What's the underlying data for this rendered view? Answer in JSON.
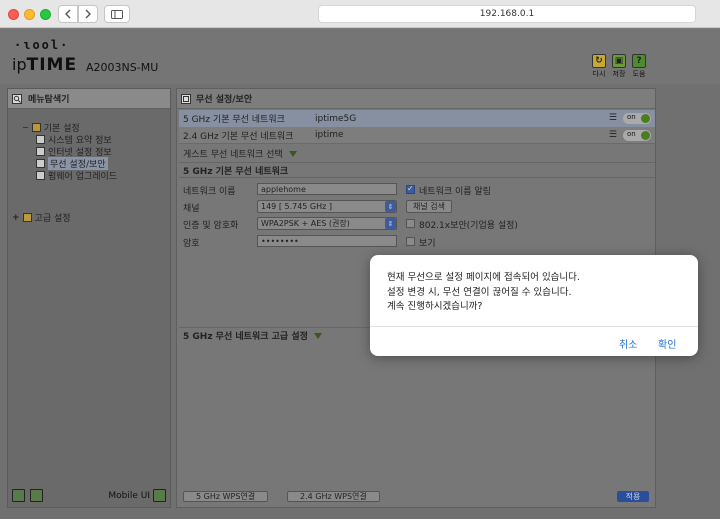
{
  "browser": {
    "url": "192.168.0.1"
  },
  "header": {
    "logo_dots": "·ɩool·",
    "logo_prefix": "ip",
    "logo_brand": "TIME",
    "model": "A2003NS-MU",
    "buttons": [
      {
        "label": "다시",
        "icon": "refresh-icon",
        "color": "#c8a830"
      },
      {
        "label": "저장",
        "icon": "save-icon",
        "color": "#6a9a3a"
      },
      {
        "label": "도움",
        "icon": "help-icon",
        "color": "#4e8a2e"
      }
    ]
  },
  "leftnav": {
    "title": "메뉴탐색기",
    "items": [
      {
        "label": "기본 설정",
        "level": 0,
        "prefix": "−"
      },
      {
        "label": "시스템 요약 정보",
        "level": 1
      },
      {
        "label": "인터넷 설정 정보",
        "level": 1
      },
      {
        "label": "무선 설정/보안",
        "level": 1,
        "selected": true
      },
      {
        "label": "펌웨어 업그레이드",
        "level": 1
      },
      {
        "label": "고급 설정",
        "level": 0,
        "prefix": "+"
      }
    ],
    "footer_label": "Mobile UI"
  },
  "main": {
    "title": "무선 설정/보안",
    "bands": [
      {
        "band": "5 GHz 기본 무선 네트워크",
        "ssid": "iptime5G",
        "toggle": "on"
      },
      {
        "band": "2.4 GHz 기본 무선 네트워크",
        "ssid": "iptime",
        "toggle": "on"
      }
    ],
    "guest_label": "게스트 무선 네트워크 선택",
    "section_title": "5 GHz 기본 무선 네트워크",
    "form": {
      "network_name_label": "네트워크 이름",
      "network_name_value": "applehome",
      "broadcast_label": "네트워크 이름 알림",
      "channel_label": "채널",
      "channel_value": "149 [ 5.745 GHz ]",
      "channel_search": "채널 검색",
      "auth_label": "인증 및 암호화",
      "auth_value": "WPA2PSK + AES (권장)",
      "enterprise_label": "802.1x보안(기업용 설정)",
      "password_label": "암호",
      "password_value": "••••••••",
      "show_label": "보기"
    },
    "advanced_title": "5 GHz 무선 네트워크 고급 설정",
    "wps_5g": "5 GHz WPS연결",
    "wps_24g": "2.4 GHz WPS연결",
    "apply": "적용"
  },
  "dialog": {
    "lines": [
      "현재 무선으로 설정 페이지에 접속되어 있습니다.",
      "설정 변경 시, 무선 연결이 끊어질 수 있습니다.",
      "계속 진행하시겠습니까?"
    ],
    "cancel": "취소",
    "ok": "확인"
  }
}
